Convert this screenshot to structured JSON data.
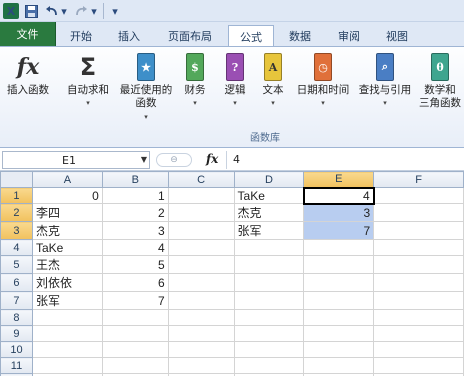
{
  "qat": {
    "logo": "X",
    "undo_dd": "▾",
    "redo_dd": "▾",
    "customize": "▾"
  },
  "tabs": [
    "文件",
    "开始",
    "插入",
    "页面布局",
    "公式",
    "数据",
    "审阅",
    "视图"
  ],
  "ribbon": {
    "buttons": [
      "插入函数",
      "自动求和",
      "最近使用的",
      "函数",
      "财务",
      "逻辑",
      "文本",
      "日期和时间",
      "查找与引用",
      "数学和",
      "三角函数"
    ],
    "group_label": "函数库"
  },
  "formula_bar": {
    "name_box": "E1",
    "fx": "fx",
    "value": "4"
  },
  "sheet": {
    "columns": [
      "A",
      "B",
      "C",
      "D",
      "E",
      "F"
    ],
    "rows": [
      [
        "1",
        "0",
        "1",
        "",
        "TaKe",
        "4",
        ""
      ],
      [
        "2",
        "李四",
        "2",
        "",
        "杰克",
        "3",
        ""
      ],
      [
        "3",
        "杰克",
        "3",
        "",
        "张军",
        "7",
        ""
      ],
      [
        "4",
        "TaKe",
        "4",
        "",
        "",
        "",
        ""
      ],
      [
        "5",
        "王杰",
        "5",
        "",
        "",
        "",
        ""
      ],
      [
        "6",
        "刘依依",
        "6",
        "",
        "",
        "",
        ""
      ],
      [
        "7",
        "张军",
        "7",
        "",
        "",
        "",
        ""
      ],
      [
        "8",
        "",
        "",
        "",
        "",
        "",
        ""
      ],
      [
        "9",
        "",
        "",
        "",
        "",
        "",
        ""
      ],
      [
        "10",
        "",
        "",
        "",
        "",
        "",
        ""
      ],
      [
        "11",
        "",
        "",
        "",
        "",
        "",
        ""
      ],
      [
        "12",
        "",
        "",
        "",
        "",
        "",
        ""
      ]
    ]
  }
}
